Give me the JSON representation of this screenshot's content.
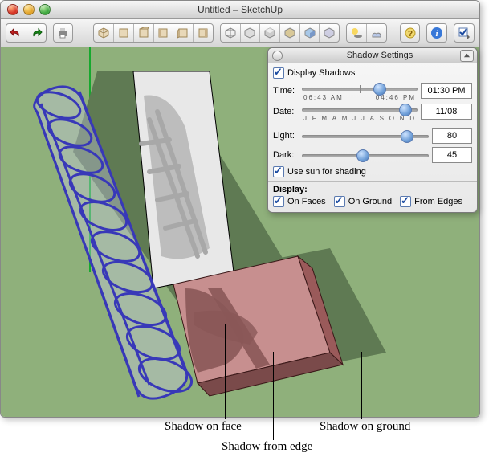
{
  "window": {
    "title": "Untitled – SketchUp"
  },
  "toolbar": {
    "undo_icon": "undo",
    "redo_icon": "redo",
    "print_icon": "print",
    "views": [
      "iso",
      "top",
      "front",
      "right",
      "back",
      "left"
    ],
    "styles": [
      "wire",
      "hidden",
      "shaded",
      "tex",
      "mono",
      "xray"
    ],
    "shadow_btn": "shadow-toggle",
    "fog_btn": "fog-toggle",
    "help_icon": "help",
    "info_icon": "info",
    "opt_icon": "options"
  },
  "panel": {
    "title": "Shadow Settings",
    "display_shadows_label": "Display Shadows",
    "display_shadows_checked": true,
    "time_label": "Time:",
    "time_min": "06:43 AM",
    "time_max": "04:46 PM",
    "time_value": "01:30 PM",
    "date_label": "Date:",
    "date_months": [
      "J",
      "F",
      "M",
      "A",
      "M",
      "J",
      "J",
      "A",
      "S",
      "O",
      "N",
      "D"
    ],
    "date_value": "11/08",
    "light_label": "Light:",
    "light_value": "80",
    "dark_label": "Dark:",
    "dark_value": "45",
    "sun_label": "Use sun for shading",
    "sun_checked": true,
    "display_label": "Display:",
    "on_faces_label": "On Faces",
    "on_ground_label": "On Ground",
    "from_edges_label": "From Edges",
    "on_faces_checked": true,
    "on_ground_checked": true,
    "from_edges_checked": true
  },
  "annotations": {
    "shadow_on_face": "Shadow on face",
    "shadow_from_edge": "Shadow from edge",
    "shadow_on_ground": "Shadow on ground"
  }
}
